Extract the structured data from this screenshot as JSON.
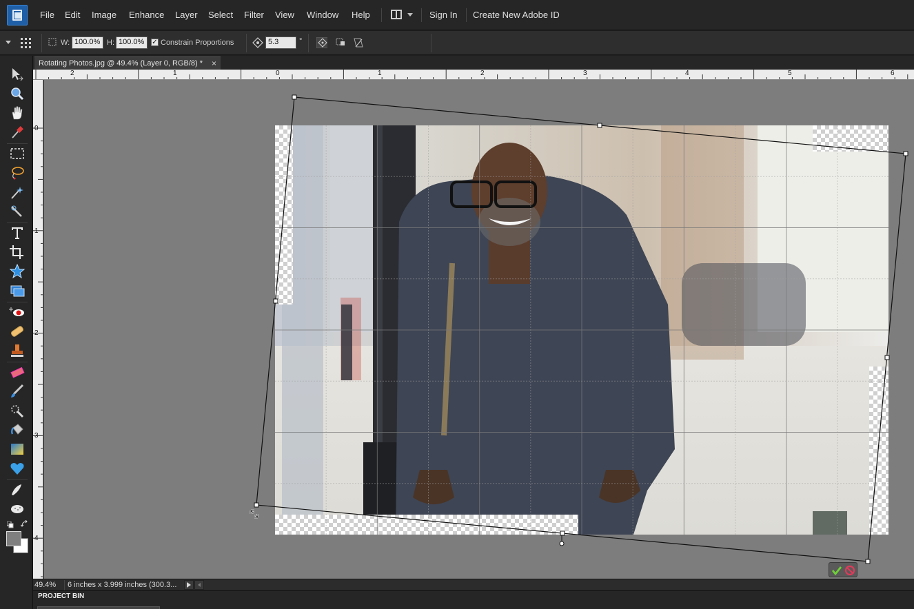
{
  "menubar": {
    "items": [
      "File",
      "Edit",
      "Image",
      "Enhance",
      "Layer",
      "Select",
      "Filter",
      "View",
      "Window",
      "Help"
    ],
    "sign_in": "Sign In",
    "create_id": "Create New Adobe ID"
  },
  "options": {
    "w_label": "W:",
    "w_value": "100.0%",
    "h_label": "H:",
    "h_value": "100.0%",
    "constrain_label": "Constrain Proportions",
    "constrain_checked": true,
    "angle_value": "5.3",
    "angle_unit": "°"
  },
  "document": {
    "tab_title": "Rotating Photos.jpg @ 49.4% (Layer 0, RGB/8) *",
    "close_glyph": "×"
  },
  "rulers": {
    "top": [
      "2",
      "1",
      "0",
      "1",
      "2",
      "3",
      "4",
      "5",
      "6"
    ],
    "left": [
      "0",
      "1",
      "2",
      "3",
      "4"
    ]
  },
  "transform": {
    "rotation_degrees": 5.3
  },
  "status": {
    "zoom": "49.4%",
    "doc_info": "6 inches x 3.999 inches (300.3..."
  },
  "project_bin": {
    "label": "PROJECT BIN"
  },
  "tools": [
    "move-tool",
    "zoom-tool",
    "hand-tool",
    "eyedropper-tool",
    "rectangular-marquee-tool",
    "lasso-tool",
    "magic-wand-tool",
    "quick-selection-tool",
    "type-tool",
    "crop-tool",
    "cookie-cutter-tool",
    "straighten-tool",
    "red-eye-tool",
    "spot-healing-tool",
    "clone-stamp-tool",
    "eraser-tool",
    "brush-tool",
    "smart-brush-tool",
    "paint-bucket-tool",
    "gradient-tool",
    "custom-shape-tool",
    "blur-tool",
    "sponge-tool"
  ],
  "colors": {
    "canvas_bg": "#7d7d7d",
    "chrome_bg": "#262626",
    "commit_green": "#5fbf2f",
    "cancel_red": "#d8334a"
  }
}
